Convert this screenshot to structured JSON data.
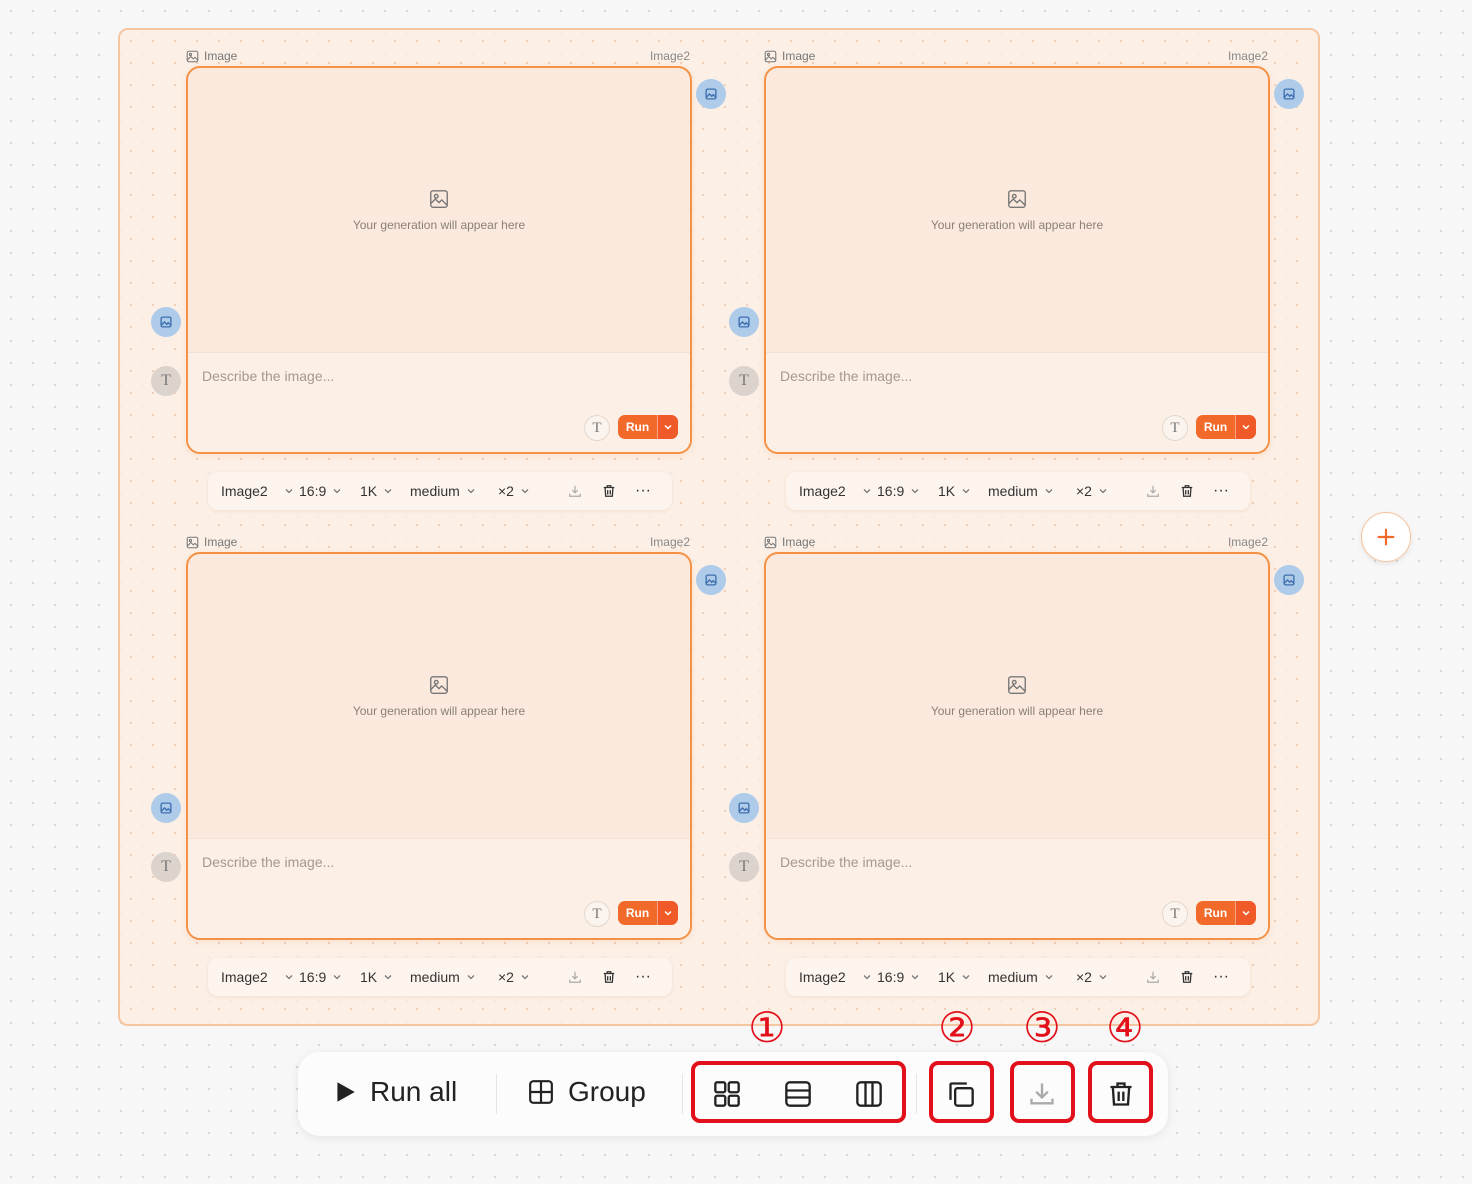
{
  "node": {
    "label": "Image",
    "model": "Image2",
    "placeholder_text": "Your generation will appear here",
    "prompt_placeholder": "Describe the image...",
    "text_handle": "T",
    "run_label": "Run"
  },
  "toolbar": {
    "model": "Image2",
    "aspect": "16:9",
    "resolution": "1K",
    "quality": "medium",
    "count": "×2",
    "more": "···"
  },
  "bottom_bar": {
    "run_all": "Run all",
    "group": "Group",
    "icons": [
      "layout-grid-icon",
      "layout-rows-icon",
      "layout-columns-icon",
      "duplicate-icon",
      "download-icon",
      "trash-icon"
    ]
  },
  "annotations": [
    "①",
    "②",
    "③",
    "④"
  ],
  "colors": {
    "accent": "#f26a2a",
    "node_border": "#f59145",
    "handle": "#aecbe9",
    "annotation": "#e2101a"
  }
}
